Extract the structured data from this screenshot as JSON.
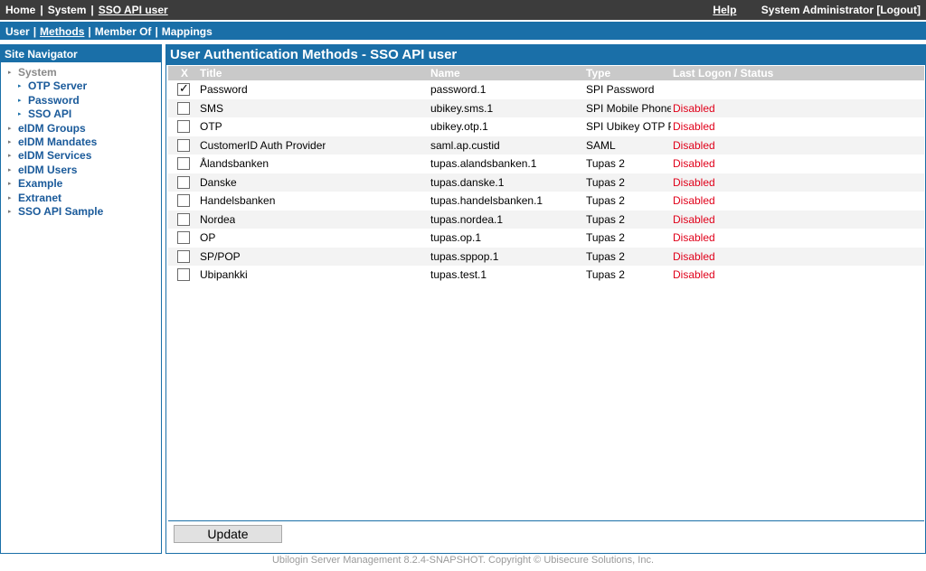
{
  "topbar": {
    "home": "Home",
    "system": "System",
    "current": "SSO API user",
    "sep": "|",
    "help": "Help",
    "admin": "System Administrator [Logout]"
  },
  "subnav": {
    "user": "User",
    "methods": "Methods",
    "member_of": "Member Of",
    "mappings": "Mappings",
    "sep": "|"
  },
  "sidebar": {
    "title": "Site Navigator",
    "items": [
      {
        "label": "System",
        "level": 0,
        "muted": true
      },
      {
        "label": "OTP Server",
        "level": 1
      },
      {
        "label": "Password",
        "level": 1
      },
      {
        "label": "SSO API",
        "level": 1
      },
      {
        "label": "eIDM Groups",
        "level": 0
      },
      {
        "label": "eIDM Mandates",
        "level": 0
      },
      {
        "label": "eIDM Services",
        "level": 0
      },
      {
        "label": "eIDM Users",
        "level": 0
      },
      {
        "label": "Example",
        "level": 0
      },
      {
        "label": "Extranet",
        "level": 0
      },
      {
        "label": "SSO API Sample",
        "level": 0
      }
    ]
  },
  "main": {
    "title": "User Authentication Methods - SSO API user",
    "columns": {
      "x": "X",
      "title": "Title",
      "name": "Name",
      "type": "Type",
      "status": "Last Logon / Status"
    },
    "rows": [
      {
        "checked": true,
        "title": "Password",
        "name": "password.1",
        "type": "SPI Password",
        "status": ""
      },
      {
        "checked": false,
        "title": "SMS",
        "name": "ubikey.sms.1",
        "type": "SPI Mobile Phone",
        "status": "Disabled"
      },
      {
        "checked": false,
        "title": "OTP",
        "name": "ubikey.otp.1",
        "type": "SPI Ubikey OTP Provider",
        "status": "Disabled"
      },
      {
        "checked": false,
        "title": "CustomerID Auth Provider",
        "name": "saml.ap.custid",
        "type": "SAML",
        "status": "Disabled"
      },
      {
        "checked": false,
        "title": "Ålandsbanken",
        "name": "tupas.alandsbanken.1",
        "type": "Tupas 2",
        "status": "Disabled"
      },
      {
        "checked": false,
        "title": "Danske",
        "name": "tupas.danske.1",
        "type": "Tupas 2",
        "status": "Disabled"
      },
      {
        "checked": false,
        "title": "Handelsbanken",
        "name": "tupas.handelsbanken.1",
        "type": "Tupas 2",
        "status": "Disabled"
      },
      {
        "checked": false,
        "title": "Nordea",
        "name": "tupas.nordea.1",
        "type": "Tupas 2",
        "status": "Disabled"
      },
      {
        "checked": false,
        "title": "OP",
        "name": "tupas.op.1",
        "type": "Tupas 2",
        "status": "Disabled"
      },
      {
        "checked": false,
        "title": "SP/POP",
        "name": "tupas.sppop.1",
        "type": "Tupas 2",
        "status": "Disabled"
      },
      {
        "checked": false,
        "title": "Ubipankki",
        "name": "tupas.test.1",
        "type": "Tupas 2",
        "status": "Disabled"
      }
    ],
    "update_label": "Update"
  },
  "footer": {
    "copyright": "Ubilogin Server Management 8.2.4-SNAPSHOT. Copyright © Ubisecure Solutions, Inc."
  },
  "colors": {
    "top_bar": "#3c3c3c",
    "accent": "#1a6fa8",
    "disabled_status": "#e0001a"
  },
  "icons": {
    "nav_arrow": "triangle-right-icon",
    "check": "checkmark-icon"
  }
}
